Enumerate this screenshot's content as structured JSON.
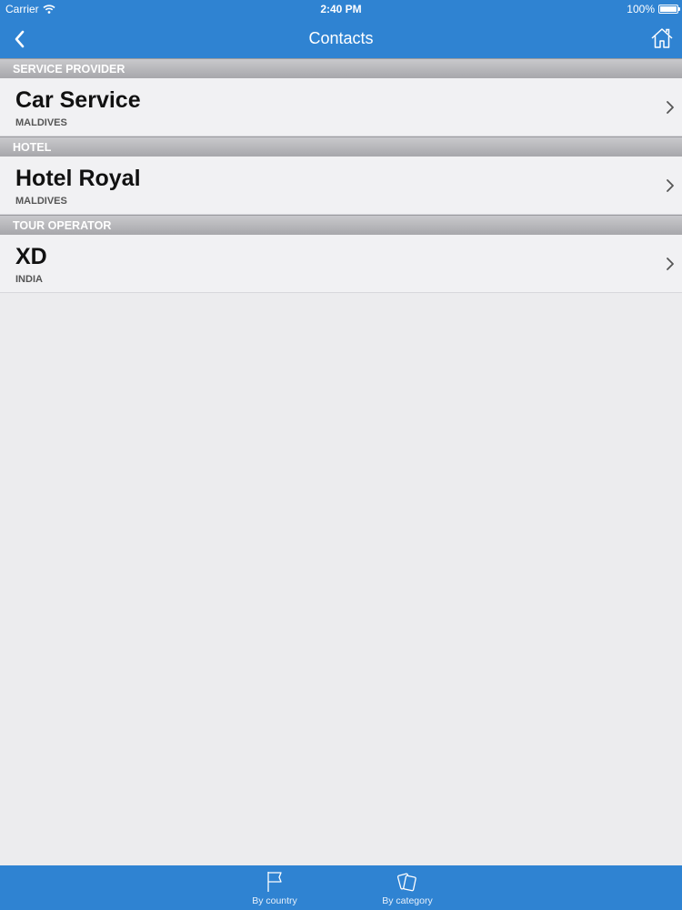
{
  "status": {
    "carrier": "Carrier",
    "time": "2:40 PM",
    "battery": "100%"
  },
  "nav": {
    "title": "Contacts",
    "back_icon": "chevron-left-icon",
    "home_icon": "home-icon"
  },
  "sections": [
    {
      "header": "SERVICE PROVIDER",
      "title": "Car Service",
      "subtitle": "MALDIVES"
    },
    {
      "header": "HOTEL",
      "title": "Hotel Royal",
      "subtitle": "MALDIVES"
    },
    {
      "header": "TOUR OPERATOR",
      "title": "XD",
      "subtitle": "INDIA"
    }
  ],
  "tabs": [
    {
      "label": "By country",
      "icon": "flag-icon"
    },
    {
      "label": "By category",
      "icon": "cards-icon"
    }
  ],
  "colors": {
    "accent": "#2f83d2",
    "background": "#ececee",
    "section_header": "#b5b5b9"
  }
}
